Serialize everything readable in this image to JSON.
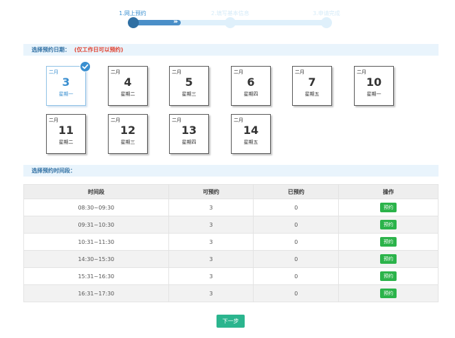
{
  "steps": [
    {
      "label": "1.网上预约",
      "state": "active"
    },
    {
      "label": "2.填写基本信息",
      "state": "inactive"
    },
    {
      "label": "3.申请完成",
      "state": "inactive"
    }
  ],
  "date_section": {
    "title": "选择预约日期：",
    "note": "(仅工作日可以预约)"
  },
  "dates": [
    {
      "month": "二月",
      "day": "3",
      "weekday": "星期一",
      "selected": true
    },
    {
      "month": "二月",
      "day": "4",
      "weekday": "星期二"
    },
    {
      "month": "二月",
      "day": "5",
      "weekday": "星期三"
    },
    {
      "month": "二月",
      "day": "6",
      "weekday": "星期四"
    },
    {
      "month": "二月",
      "day": "7",
      "weekday": "星期五"
    },
    {
      "month": "二月",
      "day": "10",
      "weekday": "星期一"
    },
    {
      "month": "二月",
      "day": "11",
      "weekday": "星期二"
    },
    {
      "month": "二月",
      "day": "12",
      "weekday": "星期三"
    },
    {
      "month": "二月",
      "day": "13",
      "weekday": "星期四"
    },
    {
      "month": "二月",
      "day": "14",
      "weekday": "星期五"
    }
  ],
  "time_section": {
    "title": "选择预约时间段："
  },
  "table": {
    "headers": [
      "时间段",
      "可预约",
      "已预约",
      "操作"
    ],
    "rows": [
      {
        "time": "08:30~09:30",
        "available": "3",
        "booked": "0",
        "action": "预约"
      },
      {
        "time": "09:31~10:30",
        "available": "3",
        "booked": "0",
        "action": "预约"
      },
      {
        "time": "10:31~11:30",
        "available": "3",
        "booked": "0",
        "action": "预约"
      },
      {
        "time": "14:30~15:30",
        "available": "3",
        "booked": "0",
        "action": "预约"
      },
      {
        "time": "15:31~16:30",
        "available": "3",
        "booked": "0",
        "action": "预约"
      },
      {
        "time": "16:31~17:30",
        "available": "3",
        "booked": "0",
        "action": "预约"
      }
    ]
  },
  "next_button": "下一步",
  "colors": {
    "accent": "#3a8fd0",
    "book": "#2bb34a",
    "next": "#2bb58e",
    "warning": "#e0402f"
  }
}
